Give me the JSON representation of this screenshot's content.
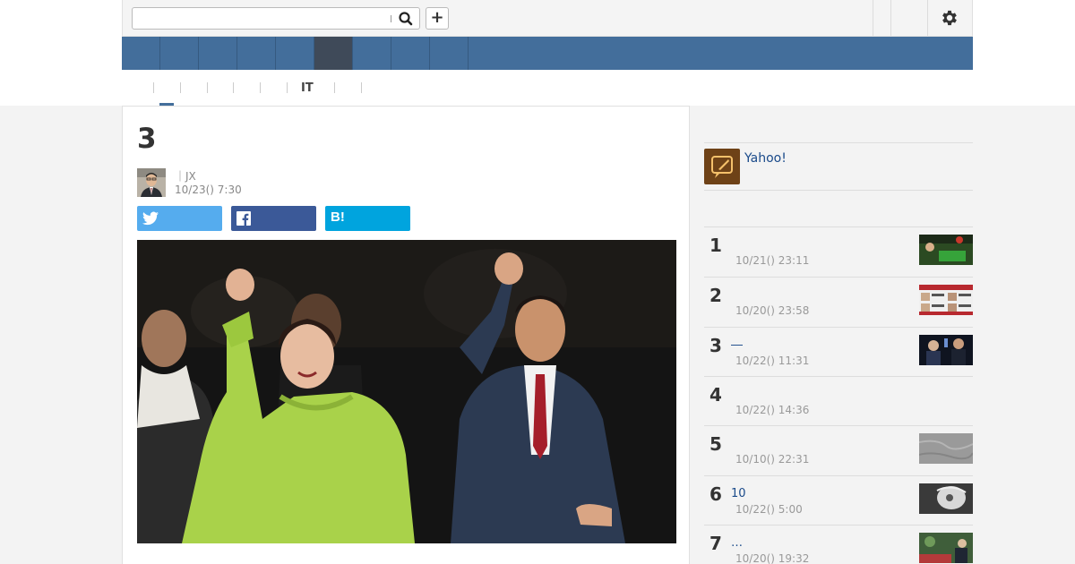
{
  "header": {
    "search_placeholder": "",
    "add_label": "+"
  },
  "subnav": {
    "it_label": "IT"
  },
  "article": {
    "title": "3",
    "byline": "｜JX",
    "date": "10/23() 7:30",
    "share_hatena": "B!"
  },
  "sidebar": {
    "yahoo_label": "Yahoo!",
    "ranking": [
      {
        "rank": "1",
        "title": "",
        "date": "10/21() 23:11"
      },
      {
        "rank": "2",
        "title": "",
        "date": "10/20() 23:58"
      },
      {
        "rank": "3",
        "title": "―",
        "date": "10/22() 11:31"
      },
      {
        "rank": "4",
        "title": "",
        "date": "10/22() 14:36"
      },
      {
        "rank": "5",
        "title": "",
        "date": "10/10() 22:31"
      },
      {
        "rank": "6",
        "title": "10",
        "date": "10/22() 5:00"
      },
      {
        "rank": "7",
        "title": "…",
        "date": "10/20() 19:32"
      }
    ]
  },
  "colors": {
    "nav": "#436e9b",
    "nav_active": "#3f4a59",
    "twitter": "#55acee",
    "facebook": "#3b5998",
    "hatena": "#00a4de",
    "link": "#1a4a8a"
  }
}
